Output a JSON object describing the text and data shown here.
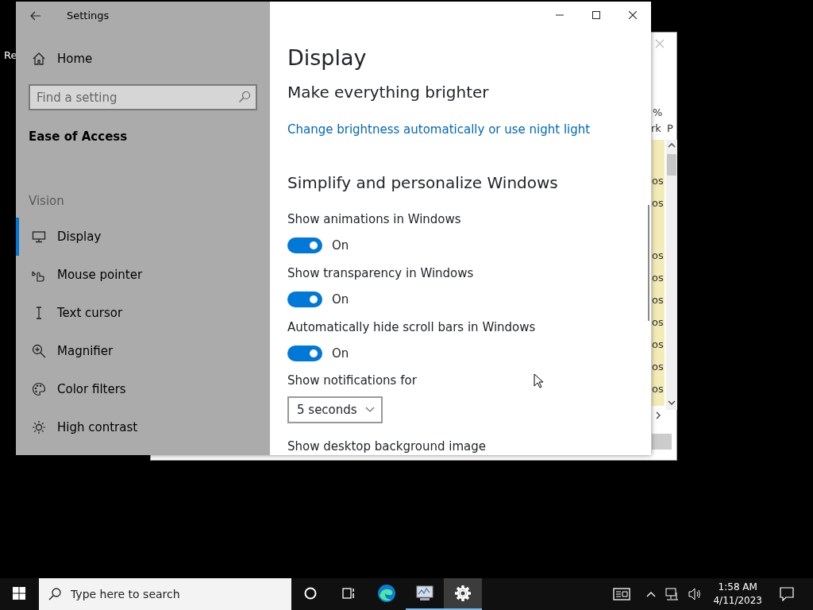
{
  "desktop": {
    "label": "Re"
  },
  "background_window": {
    "headers": [
      "%",
      "rk",
      "P"
    ],
    "rows": [
      "os",
      "os",
      "os",
      "os",
      "os",
      "os",
      "os",
      "os",
      "os"
    ]
  },
  "settings": {
    "title": "Settings",
    "home": "Home",
    "search": {
      "placeholder": "Find a setting"
    },
    "category": "Ease of Access",
    "group": "Vision",
    "nav": [
      {
        "label": "Display",
        "kind": "monitor",
        "selected": true
      },
      {
        "label": "Mouse pointer",
        "kind": "pointer",
        "selected": false
      },
      {
        "label": "Text cursor",
        "kind": "cursor",
        "selected": false
      },
      {
        "label": "Magnifier",
        "kind": "magnifier",
        "selected": false
      },
      {
        "label": "Color filters",
        "kind": "palette",
        "selected": false
      },
      {
        "label": "High contrast",
        "kind": "sun",
        "selected": false
      }
    ]
  },
  "content": {
    "title": "Display",
    "section_1": "Make everything brighter",
    "link": "Change brightness automatically or use night light",
    "section_2": "Simplify and personalize Windows",
    "toggles": [
      {
        "label": "Show animations in Windows",
        "on": true,
        "state_text": "On"
      },
      {
        "label": "Show transparency in Windows",
        "on": true,
        "state_text": "On"
      },
      {
        "label": "Automatically hide scroll bars in Windows",
        "on": true,
        "state_text": "On"
      }
    ],
    "dropdown": {
      "label": "Show notifications for",
      "value": "5 seconds"
    },
    "cut_label": "Show desktop background image"
  },
  "taskbar": {
    "search": {
      "placeholder": "Type here to search"
    },
    "apps": [
      {
        "kind": "cortana",
        "running": false,
        "selected": false
      },
      {
        "kind": "taskview",
        "running": false,
        "selected": false
      },
      {
        "kind": "browser",
        "running": false,
        "selected": false
      },
      {
        "kind": "monitor",
        "running": true,
        "selected": false
      },
      {
        "kind": "settings",
        "running": true,
        "selected": true
      }
    ],
    "time": "1:58 AM",
    "date": "4/11/2023"
  }
}
